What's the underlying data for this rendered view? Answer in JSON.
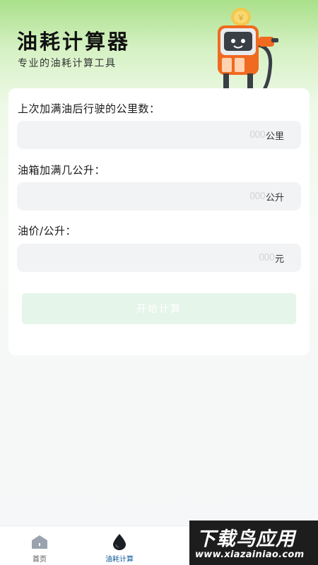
{
  "header": {
    "title": "油耗计算器",
    "subtitle": "专业的油耗计算工具"
  },
  "form": {
    "distance": {
      "label": "上次加满油后行驶的公里数：",
      "placeholder": "000",
      "unit": "公里"
    },
    "tank": {
      "label": "油箱加满几公升：",
      "placeholder": "000",
      "unit": "公升"
    },
    "price": {
      "label": "油价/公升：",
      "placeholder": "000",
      "unit": "元"
    },
    "submit_label": "开始计算"
  },
  "tabbar": {
    "items": [
      {
        "label": "首页",
        "icon": "home-icon",
        "active": false
      },
      {
        "label": "油耗计算",
        "icon": "oil-drop-icon",
        "active": true
      }
    ],
    "active_color": "#0f5b9a"
  },
  "watermark": {
    "text": "下载鸟应用",
    "url": "www.xiazainiao.com"
  },
  "colors": {
    "accent_green": "#a9e08a",
    "button_disabled": "#e5f5ea"
  }
}
